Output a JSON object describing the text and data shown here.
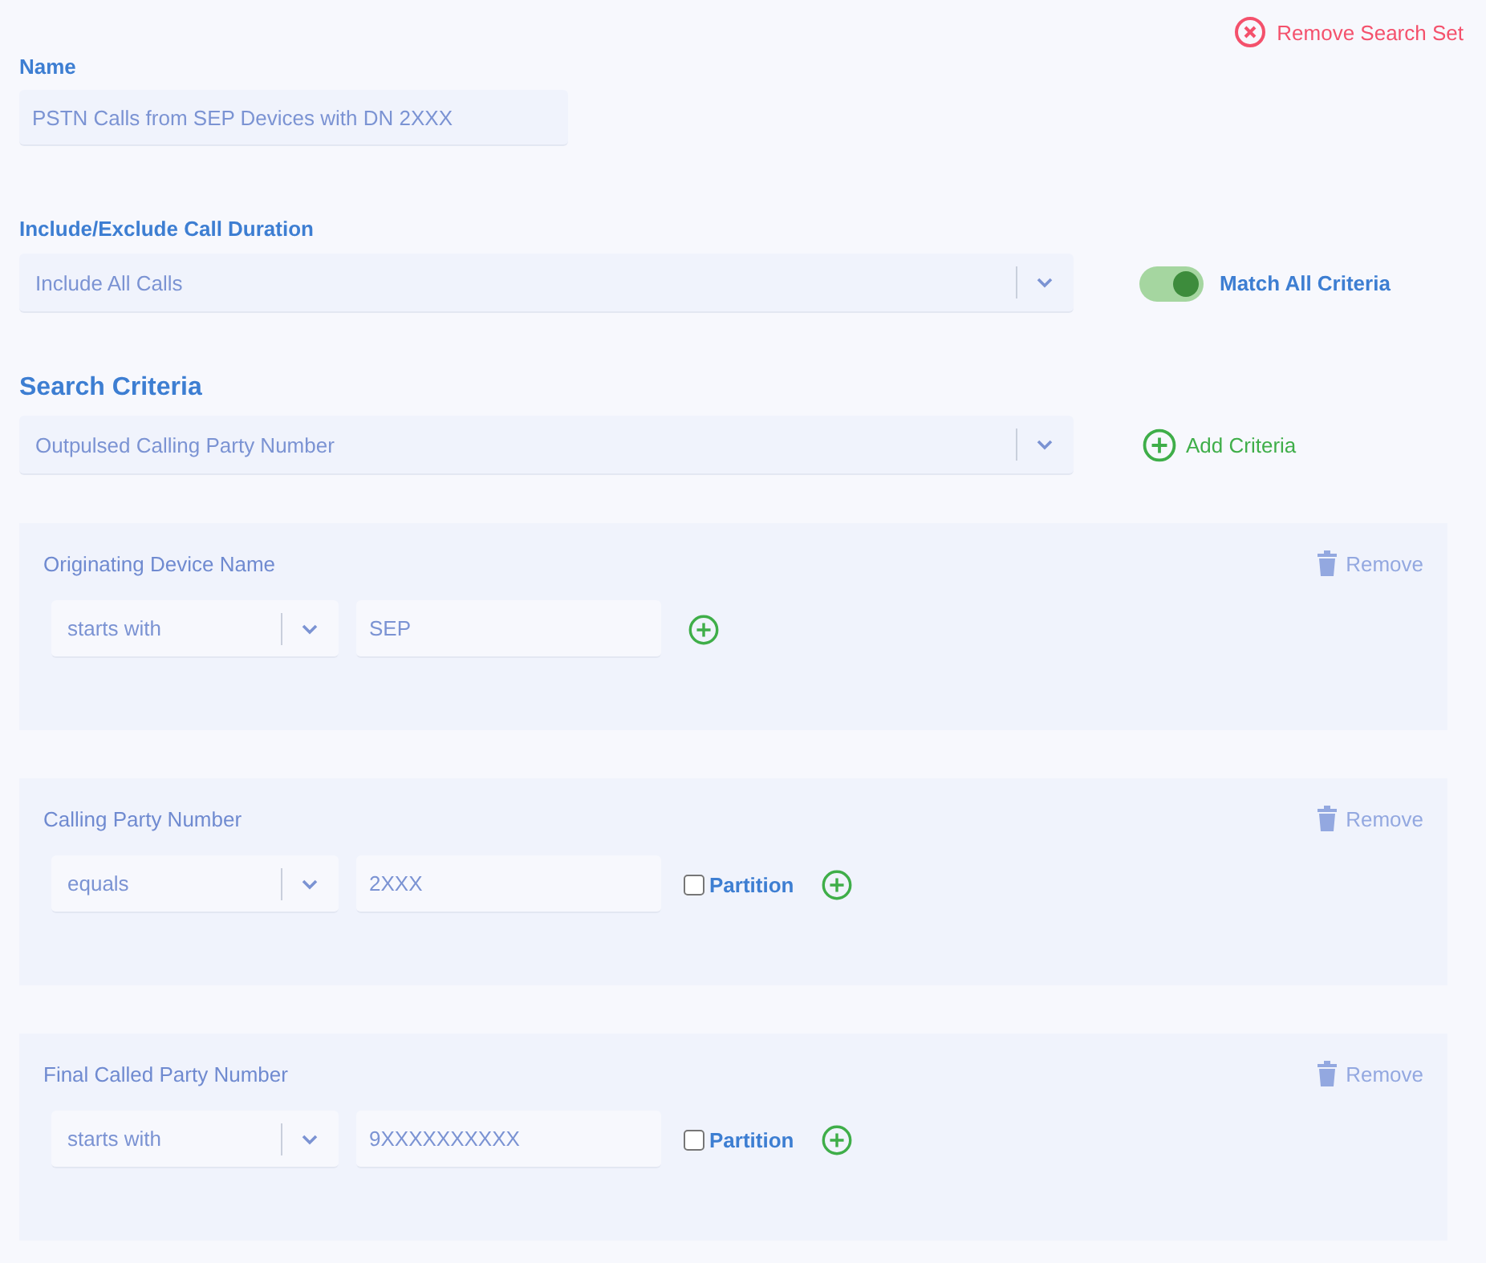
{
  "remove_search_set": "Remove Search Set",
  "name": {
    "label": "Name",
    "value": "PSTN Calls from SEP Devices with DN 2XXX"
  },
  "call_duration": {
    "label": "Include/Exclude Call Duration",
    "value": "Include All Calls"
  },
  "match_all": {
    "label": "Match All Criteria",
    "on": true
  },
  "search_criteria": {
    "title": "Search Criteria",
    "value": "Outpulsed Calling Party Number",
    "add_label": "Add Criteria"
  },
  "criteria": [
    {
      "title": "Originating Device Name",
      "remove": "Remove",
      "remove_disabled": true,
      "operator": "starts with",
      "value": "SEP"
    },
    {
      "title": "Calling Party Number",
      "remove": "Remove",
      "remove_disabled": true,
      "operator": "equals",
      "value": "2XXX",
      "partition": {
        "label": "Partition",
        "checked": false
      }
    },
    {
      "title": "Final Called Party Number",
      "remove": "Remove",
      "remove_disabled": true,
      "operator": "starts with",
      "value": "9XXXXXXXXXX",
      "partition": {
        "label": "Partition",
        "checked": false
      }
    }
  ]
}
